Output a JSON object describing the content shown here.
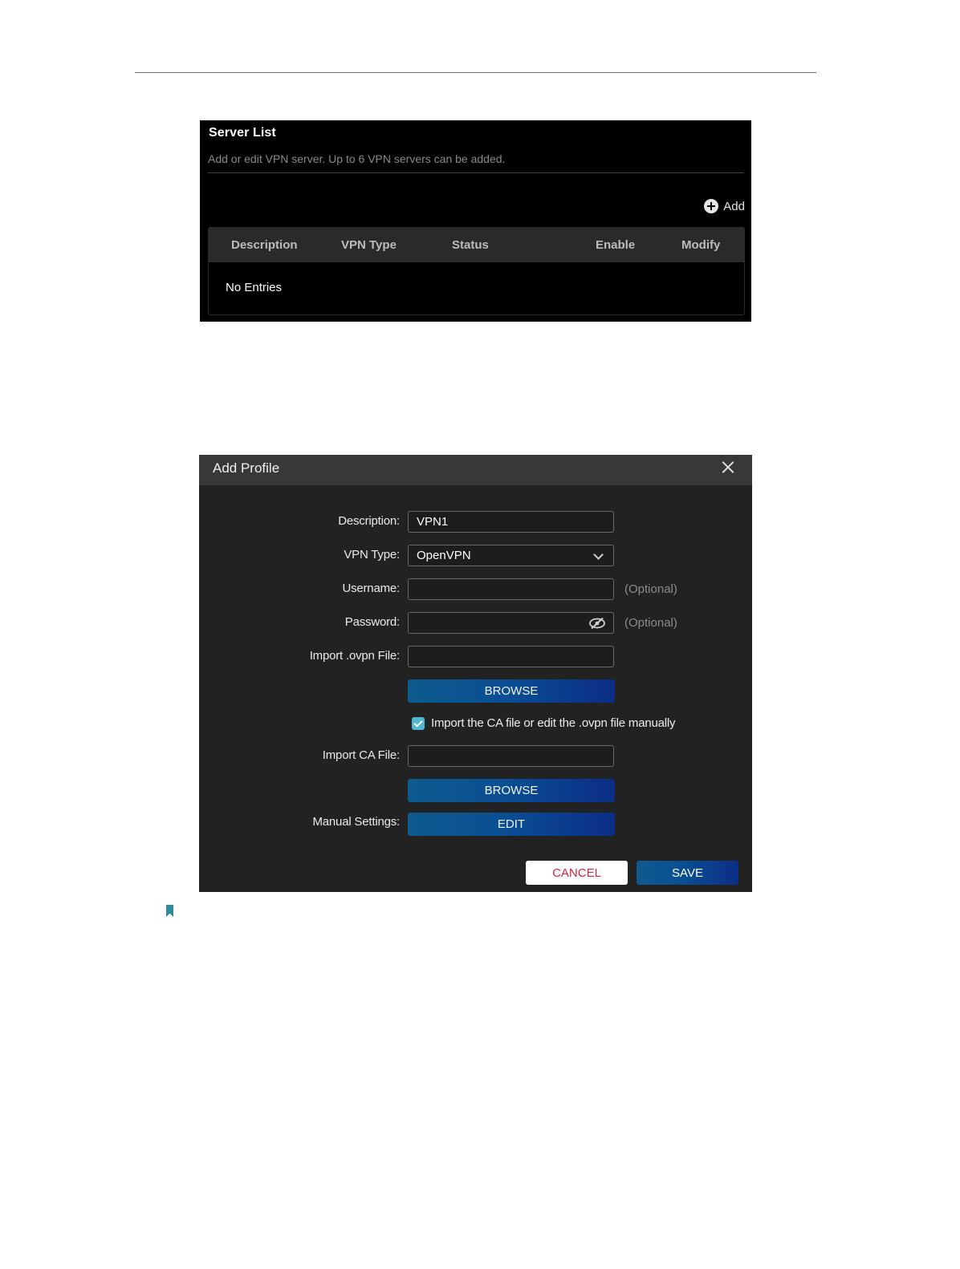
{
  "server_list": {
    "title": "Server List",
    "description": "Add or edit VPN server. Up to 6 VPN servers can be added.",
    "add_label": "Add",
    "columns": [
      "Description",
      "VPN Type",
      "Status",
      "Enable",
      "Modify"
    ],
    "empty_text": "No Entries"
  },
  "add_profile": {
    "title": "Add Profile",
    "description_label": "Description:",
    "description_value": "VPN1",
    "vpn_type_label": "VPN Type:",
    "vpn_type_value": "OpenVPN",
    "username_label": "Username:",
    "username_hint": "(Optional)",
    "password_label": "Password:",
    "password_hint": "(Optional)",
    "import_ovpn_label": "Import .ovpn File:",
    "browse_label": "BROWSE",
    "checkbox_label": "Import the CA file or edit the .ovpn file manually",
    "checkbox_checked": true,
    "import_ca_label": "Import CA File:",
    "browse_ca_label": "BROWSE",
    "manual_settings_label": "Manual Settings:",
    "edit_label": "EDIT",
    "cancel_label": "CANCEL",
    "save_label": "SAVE"
  },
  "colors": {
    "accent_blue": "#0a4d93",
    "cancel_red": "#d5243f",
    "checkbox": "#4fb7d2",
    "note_icon": "#2f8a9c"
  },
  "icons": [
    "plus-circle-icon",
    "close-icon",
    "chevron-down-icon",
    "eye-off-icon",
    "bookmark-icon"
  ]
}
